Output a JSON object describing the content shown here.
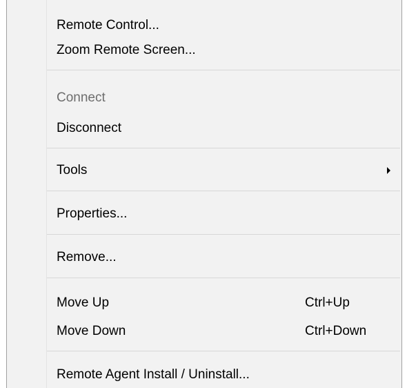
{
  "menu": {
    "items": {
      "remote_control": {
        "label": "Remote Control..."
      },
      "zoom_remote_screen": {
        "label": "Zoom Remote Screen..."
      },
      "connect": {
        "label": "Connect",
        "state": "disabled"
      },
      "disconnect": {
        "label": "Disconnect"
      },
      "tools": {
        "label": "Tools",
        "submenu_icon": "triangle-right-icon"
      },
      "properties": {
        "label": "Properties..."
      },
      "remove": {
        "label": "Remove..."
      },
      "move_up": {
        "label": "Move Up",
        "shortcut": "Ctrl+Up"
      },
      "move_down": {
        "label": "Move Down",
        "shortcut": "Ctrl+Down"
      },
      "remote_agent": {
        "label": "Remote Agent Install / Uninstall..."
      }
    }
  }
}
